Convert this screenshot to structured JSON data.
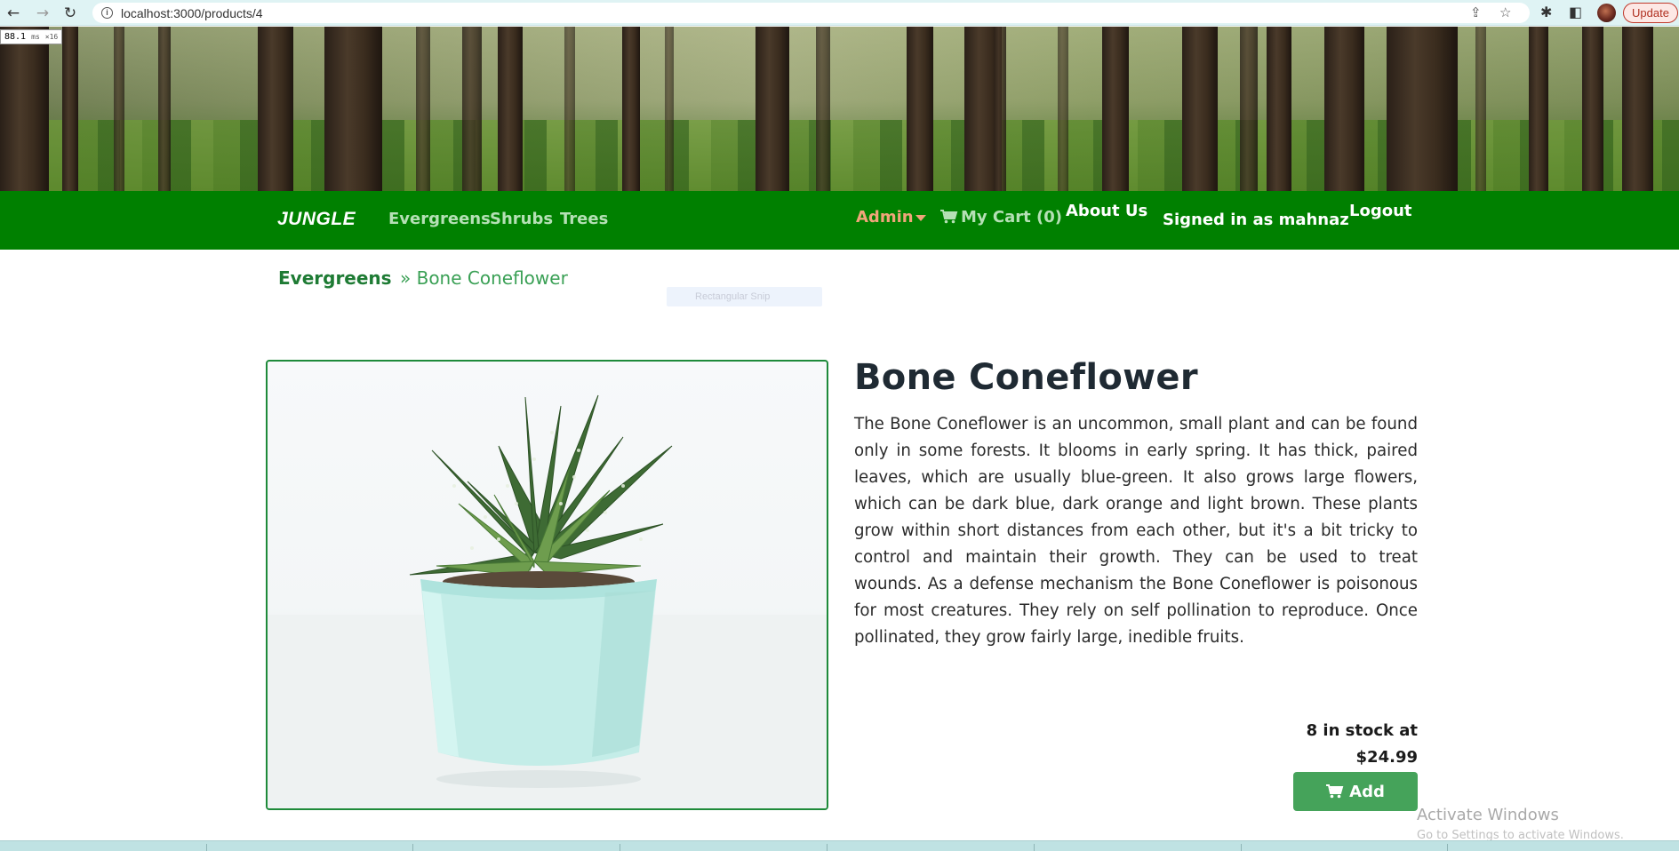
{
  "browser": {
    "url": "localhost:3000/products/4",
    "update_label": "Update",
    "perf_value": "88.1",
    "perf_unit": "ms",
    "perf_extra": "×16"
  },
  "nav": {
    "brand": "JUNGLE",
    "categories": [
      "Evergreens",
      "Shrubs",
      "Trees"
    ],
    "admin_label": "Admin",
    "cart_label": "My Cart (0)",
    "about_label": "About Us",
    "signed_in_label": "Signed in as mahnaz",
    "logout_label": "Logout"
  },
  "breadcrumb": {
    "parent": "Evergreens",
    "current": "» Bone Coneflower"
  },
  "snip_ghost": "Rectangular Snip",
  "product": {
    "name": "Bone Coneflower",
    "description": "The Bone Coneflower is an uncommon, small plant and can be found only in some forests. It blooms in early spring. It has thick, paired leaves, which are usually blue-green. It also grows large flowers, which can be dark blue, dark orange and light brown. These plants grow within short distances from each other, but it's a bit tricky to control and maintain their growth. They can be used to treat wounds. As a defense mechanism the Bone Coneflower is poisonous for most creatures. They rely on self pollination to reproduce. Once pollinated, they grow fairly large, inedible fruits.",
    "stock_text": "8 in stock at",
    "price": "$24.99",
    "add_label": "Add"
  },
  "watermark": {
    "title": "Activate Windows",
    "subtitle": "Go to Settings to activate Windows."
  },
  "colors": {
    "navbar": "#008000",
    "nav_link": "#b5e0b5",
    "admin": "#f0a57a",
    "button": "#45a35a",
    "breadcrumb": "#1e7b34"
  }
}
